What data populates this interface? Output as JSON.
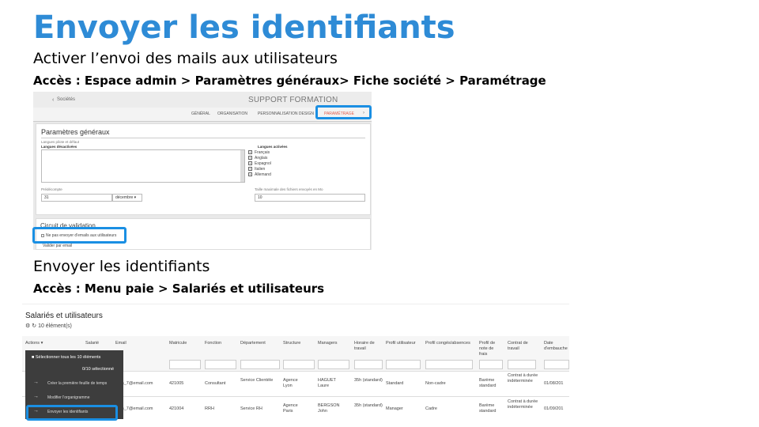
{
  "title": "Envoyer les identifiants",
  "subtitle": "Activer l’envoi des mails aux utilisateurs",
  "path1": "Accès : Espace admin > Paramètres généraux> Fiche société > Paramétrage",
  "section2_title": "Envoyer les identifiants",
  "path2": "Accès : Menu paie > Salariés et utilisateurs",
  "accent_color": "#2e8bd6",
  "highlight_color": "#1a8fe3",
  "shot1": {
    "back_link": "Sociétés",
    "company": "SUPPORT FORMATION",
    "tabs": [
      "GÉNÉRAL",
      "ORGANISATION",
      "PERSONNALISATION DESIGN",
      "PARAMÉTRAGE"
    ],
    "panel_title": "Paramètres généraux",
    "lang_primary_label": "Langues pilote et défaut",
    "lang_unselected_label": "Langues désactivées",
    "lang_active_label": "Langues activées",
    "languages": [
      "Français",
      "Anglais",
      "Espagnol",
      "Italien",
      "Allemand"
    ],
    "period_label": "Prédécompte",
    "period_value": "31",
    "period_month": "décembre",
    "size_label": "Taille maximale des fichiers envoyés en Mo",
    "size_value": "10",
    "validation_title": "Circuit de validation",
    "no_email_label": "Ne pas envoyer d'emails aux utilisateurs",
    "validate_label": "Valider par email"
  },
  "shot2": {
    "title": "Salariés et utilisateurs",
    "count": "10 élément(s)",
    "actions_label": "Actions",
    "headers": [
      "Salarié",
      "Email",
      "Matricule",
      "Fonction",
      "Département",
      "Structure",
      "Managers",
      "Horaire de travail",
      "Profil utilisateur",
      "Profil congés/absences",
      "Profil de note de frais",
      "Contrat de travail",
      "Date d'embauche"
    ],
    "menu": {
      "select_all": "Sélectionner tous les 10 éléments",
      "selected_count": "0/10 sélectionné",
      "items": [
        "Créer la première feuille de temps",
        "Modifier l'organigramme",
        "Envoyer les identifiants"
      ]
    },
    "rows": [
      {
        "email": "...on_7@email.com",
        "matricule": "421005",
        "fonction": "Consultant",
        "departement": "Service Clientèle",
        "structure": "Agence Lyon",
        "manager": "HAGUET Laure",
        "horaire": "35h (standard)",
        "profil_user": "Standard",
        "profil_conges": "Non-cadre",
        "profil_ndf": "Barème standard",
        "contrat": "Contrat à durée indéterminée",
        "date": "01/08/201"
      },
      {
        "email": "...on_7@email.com",
        "matricule": "421004",
        "fonction": "RRH",
        "departement": "Service RH",
        "structure": "Agence Paris",
        "manager": "BERGSON John",
        "horaire": "35h (standard)",
        "profil_user": "Manager",
        "profil_conges": "Cadre",
        "profil_ndf": "Barème standard",
        "contrat": "Contrat à durée indéterminée",
        "date": "01/09/201"
      }
    ]
  }
}
